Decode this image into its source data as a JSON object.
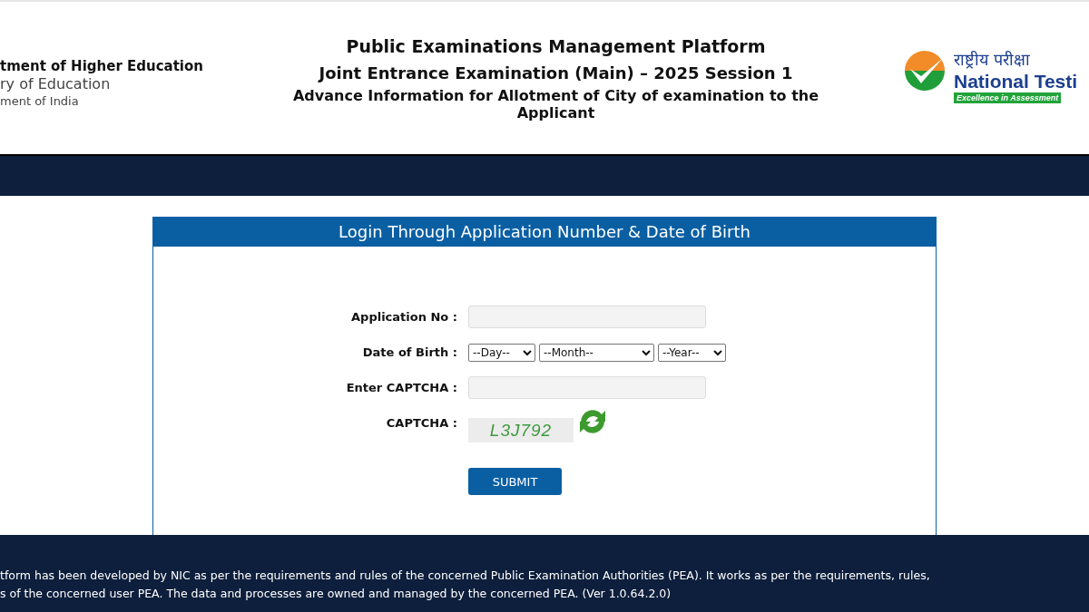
{
  "header": {
    "ministry_lines": [
      "tment of Higher Education",
      "ry of Education",
      "ment of India"
    ],
    "titles": [
      "Public Examinations Management Platform",
      "Joint Entrance Examination (Main) – 2025 Session 1",
      "Advance Information for Allotment of City of examination to the Applicant"
    ],
    "agency": {
      "hindi": "राष्ट्रीय परीक्षा",
      "english": "National Testi",
      "tagline": "Excellence in Assessment"
    }
  },
  "login": {
    "title": "Login Through Application Number & Date of Birth",
    "rows": [
      {
        "kind": "input",
        "label": "Application No :"
      },
      {
        "kind": "selects",
        "label": "Date of Birth :",
        "selects": [
          "--Day--",
          "--Month--",
          "--Year--"
        ]
      },
      {
        "kind": "input",
        "label": "Enter CAPTCHA :"
      },
      {
        "kind": "captcha",
        "label": "CAPTCHA :",
        "value": "L3J792"
      }
    ],
    "submit": "SUBMIT"
  },
  "footer": {
    "lines": [
      "tform has been developed by NIC as per the requirements and rules of the concerned Public Examination Authorities (PEA). It works as per the requirements, rules,",
      "s of the concerned user PEA. The data and processes are owned and managed by the concerned PEA. (Ver 1.0.64.2.0)"
    ]
  }
}
